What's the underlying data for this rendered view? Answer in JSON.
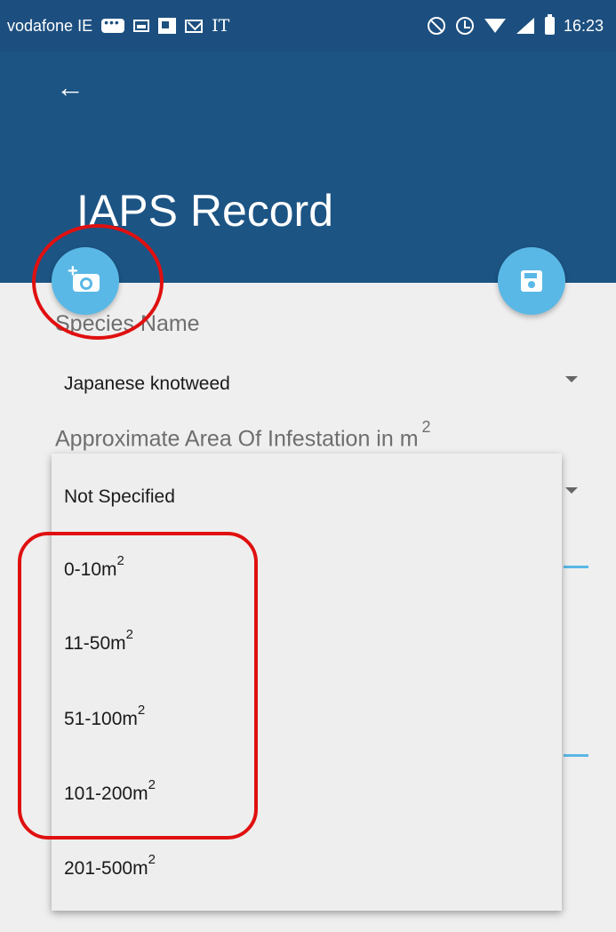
{
  "status_bar": {
    "carrier": "vodafone IE",
    "indicator_text": "IT",
    "time": "16:23",
    "icons": [
      "message-icon",
      "image-icon",
      "flipboard-icon",
      "mail-icon",
      "do-not-disturb-icon",
      "alarm-icon",
      "wifi-icon",
      "signal-icon",
      "battery-icon"
    ]
  },
  "app_bar": {
    "back_icon": "arrow-back-icon",
    "title": "IAPS Record",
    "color": "#1c5484"
  },
  "fabs": {
    "camera_icon": "add-photo-icon",
    "save_icon": "save-icon",
    "color": "#5ab8e6"
  },
  "species": {
    "label": "Species Name",
    "value": "Japanese knotweed"
  },
  "area": {
    "label": "Approximate Area Of Infestation in m",
    "label_superscript": "2",
    "options": [
      {
        "base": "Not Specified",
        "sup": ""
      },
      {
        "base": "0-10m",
        "sup": "2"
      },
      {
        "base": "11-50m",
        "sup": "2"
      },
      {
        "base": "51-100m",
        "sup": "2"
      },
      {
        "base": "101-200m",
        "sup": "2"
      },
      {
        "base": "201-500m",
        "sup": "2"
      }
    ]
  },
  "annotation_color": "#e01010"
}
